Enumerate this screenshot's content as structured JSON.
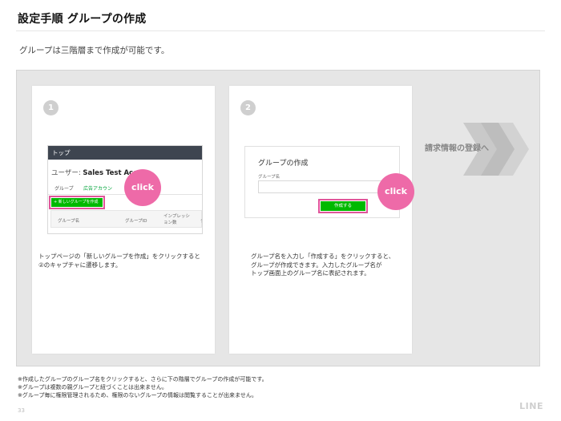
{
  "header": {
    "title": "設定手順 グループの作成",
    "subtitle": "グループは三階層まで作成が可能です。"
  },
  "steps": [
    {
      "number": "1",
      "screenshot": {
        "header": "トップ",
        "user_prefix": "ユーザー: ",
        "user_name": "Sales Test Acc",
        "tabs": [
          "グループ",
          "広告アカウン"
        ],
        "new_group_button": "+ 新しいグループを作成",
        "table_headers": [
          "グループ名",
          "グループID",
          "インプレッション数",
          "ク"
        ]
      },
      "callout": "click",
      "description": [
        "トップページの「新しいグループを作成」をクリックすると",
        "②のキャプチャに遷移します。"
      ]
    },
    {
      "number": "2",
      "screenshot": {
        "title": "グループの作成",
        "field_label": "グループ名",
        "field_value": "",
        "create_button": "作成する"
      },
      "callout": "click",
      "description": [
        "グループ名を入力し「作成する」をクリックすると、",
        "グループが作成できます。入力したグループ名が",
        "トップ画面上のグループ名に表記されます。"
      ]
    }
  ],
  "next": {
    "label": "請求情報の登録へ"
  },
  "notes": [
    "※作成したグループのグループ名をクリックすると、さらに下の階層でグループの作成が可能です。",
    "※グループは複数の親グループと紐づくことは出来ません。",
    "※グループ毎に権限管理されるため、権限のないグループの情報は閲覧することが出来ません。"
  ],
  "footer": {
    "page_number": "33",
    "logo": "LINE"
  },
  "colors": {
    "accent_green": "#00b900",
    "highlight_pink": "#e0559a",
    "callout_pink": "#ee6aa8",
    "panel_gray": "#e6e6e6"
  }
}
